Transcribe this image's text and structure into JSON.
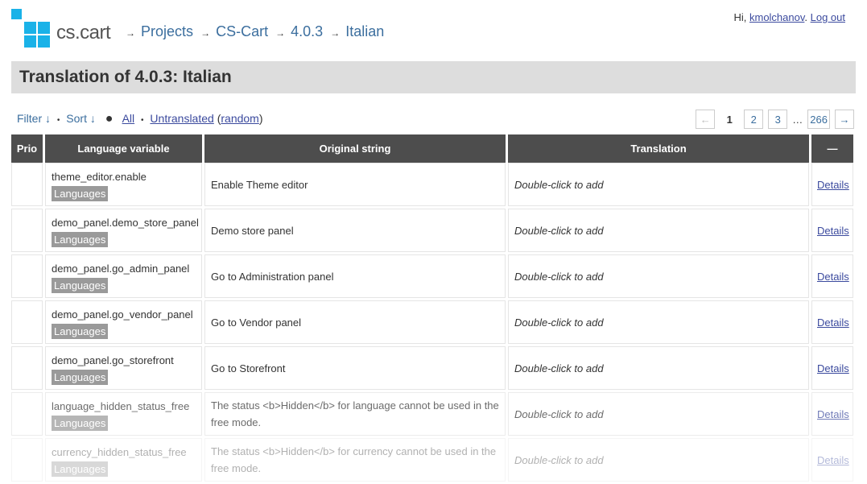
{
  "header": {
    "logo_text": "cs.cart",
    "brand_color": "#1ab2e8",
    "breadcrumb": [
      "Projects",
      "CS-Cart",
      "4.0.3",
      "Italian"
    ],
    "breadcrumb_arrow": "→",
    "user_greeting": "Hi,",
    "username": "kmolchanov",
    "logout_label": "Log out"
  },
  "title": "Translation of 4.0.3: Italian",
  "filters": {
    "filter_label": "Filter ↓",
    "sort_label": "Sort ↓",
    "all_label": "All",
    "untranslated_label": "Untranslated",
    "random_label": "random"
  },
  "pager": {
    "prev": "←",
    "pages": [
      "1",
      "2",
      "3"
    ],
    "current": "1",
    "ellipsis": "…",
    "last": "266",
    "next": "→"
  },
  "table": {
    "headers": {
      "prio": "Prio",
      "variable": "Language variable",
      "original": "Original string",
      "translation": "Translation",
      "actions": "—"
    },
    "placeholder": "Double-click to add",
    "details_label": "Details",
    "rows": [
      {
        "variable": "theme_editor.enable",
        "tag": "Languages",
        "original": "Enable Theme editor"
      },
      {
        "variable": "demo_panel.demo_store_panel",
        "tag": "Languages",
        "original": "Demo store panel"
      },
      {
        "variable": "demo_panel.go_admin_panel",
        "tag": "Languages",
        "original": "Go to Administration panel"
      },
      {
        "variable": "demo_panel.go_vendor_panel",
        "tag": "Languages",
        "original": "Go to Vendor panel"
      },
      {
        "variable": "demo_panel.go_storefront",
        "tag": "Languages",
        "original": "Go to Storefront"
      },
      {
        "variable": "language_hidden_status_free",
        "tag": "Languages",
        "original": "The status <b>Hidden</b> for language cannot be used in the free mode."
      },
      {
        "variable": "currency_hidden_status_free",
        "tag": "Languages",
        "original": "The status <b>Hidden</b> for currency cannot be used in the free mode."
      }
    ]
  }
}
